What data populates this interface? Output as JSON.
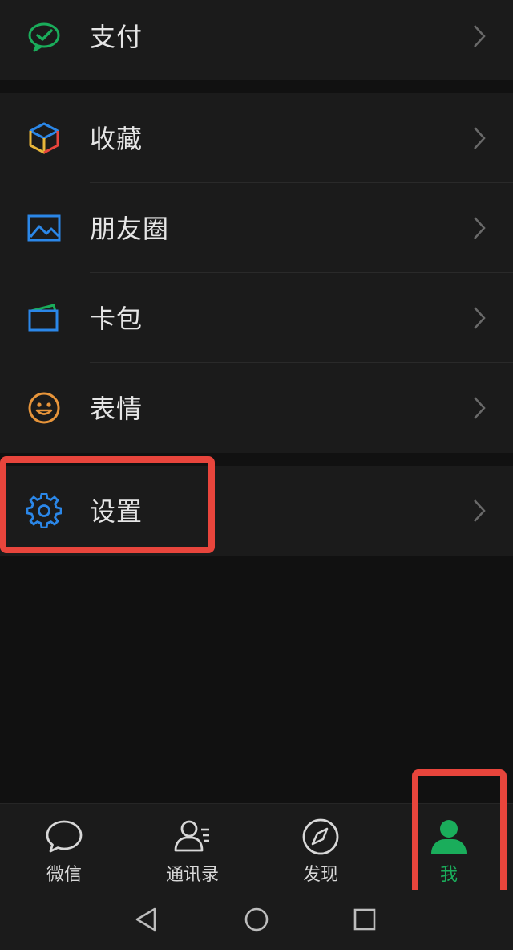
{
  "menu": {
    "pay": {
      "label": "支付",
      "icon": "wechat-pay-icon"
    },
    "favorites": {
      "label": "收藏",
      "icon": "cube-icon"
    },
    "moments": {
      "label": "朋友圈",
      "icon": "picture-icon"
    },
    "cards": {
      "label": "卡包",
      "icon": "card-wallet-icon"
    },
    "stickers": {
      "label": "表情",
      "icon": "smiley-icon"
    },
    "settings": {
      "label": "设置",
      "icon": "gear-icon"
    }
  },
  "tabbar": {
    "tabs": [
      {
        "label": "微信",
        "icon": "chat-bubble-icon",
        "active": false
      },
      {
        "label": "通讯录",
        "icon": "contacts-icon",
        "active": false
      },
      {
        "label": "发现",
        "icon": "compass-icon",
        "active": false
      },
      {
        "label": "我",
        "icon": "person-icon",
        "active": true
      }
    ]
  },
  "colors": {
    "background": "#111111",
    "row_background": "#1b1b1b",
    "accent_green": "#1aad5b",
    "highlight_red": "#e8453c",
    "settings_blue": "#2b87e8",
    "stickers_orange": "#e8953a"
  },
  "navbar": {
    "back": "back-triangle-icon",
    "home": "home-circle-icon",
    "recents": "recents-square-icon"
  }
}
